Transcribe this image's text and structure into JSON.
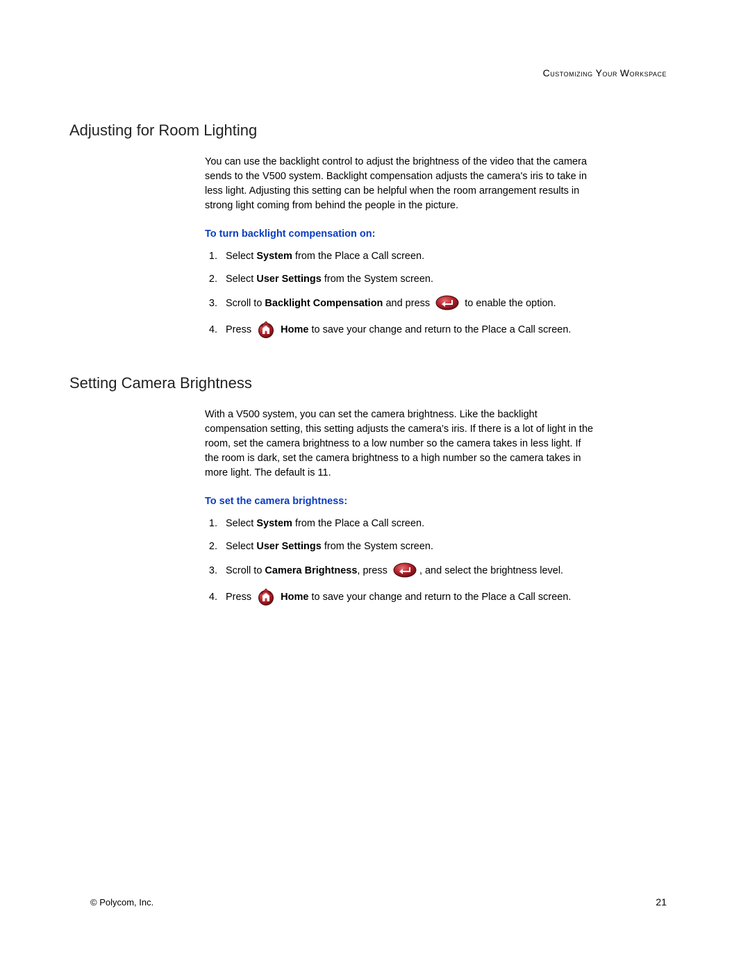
{
  "running_head": "Customizing Your Workspace",
  "footer": {
    "copyright": "© Polycom, Inc.",
    "page_number": "21"
  },
  "sections": [
    {
      "heading": "Adjusting for Room Lighting",
      "intro": "You can use the backlight control to adjust the brightness of the video that the camera sends to the V500 system. Backlight compensation adjusts the camera's iris to take in less light. Adjusting this setting can be helpful when the room arrangement results in strong light coming from behind the people in the picture.",
      "subhead": "To turn backlight compensation on:",
      "steps": [
        {
          "prefix": "Select ",
          "bold": "System",
          "suffix": " from the Place a Call screen."
        },
        {
          "prefix": "Select ",
          "bold": "User Settings",
          "suffix": " from the System screen."
        },
        {
          "prefix": "Scroll to ",
          "bold": "Backlight Compensation",
          "mid": " and press ",
          "icon": "enter",
          "suffix": " to enable the option."
        },
        {
          "prefix": "Press ",
          "icon": "home",
          "bold_after_icon": "Home",
          "suffix": " to save your change and return to the Place a Call screen."
        }
      ]
    },
    {
      "heading": "Setting Camera Brightness",
      "intro": "With a V500 system, you can set the camera brightness. Like the backlight compensation setting, this setting adjusts the camera’s iris. If there is a lot of light in the room, set the camera brightness to a low number so the camera takes in less light. If the room is dark, set the camera brightness to a high number so the camera takes in more light. The default is 11.",
      "subhead": "To set the camera brightness:",
      "steps": [
        {
          "prefix": "Select ",
          "bold": "System",
          "suffix": " from the Place a Call screen."
        },
        {
          "prefix": "Select ",
          "bold": "User Settings",
          "suffix": " from the System screen."
        },
        {
          "prefix": "Scroll to ",
          "bold": "Camera Brightness",
          "mid": ", press ",
          "icon": "enter",
          "suffix": ", and select the brightness level."
        },
        {
          "prefix": "Press ",
          "icon": "home",
          "bold_after_icon": "Home",
          "suffix": " to save your change and return to the Place a Call screen."
        }
      ]
    }
  ]
}
